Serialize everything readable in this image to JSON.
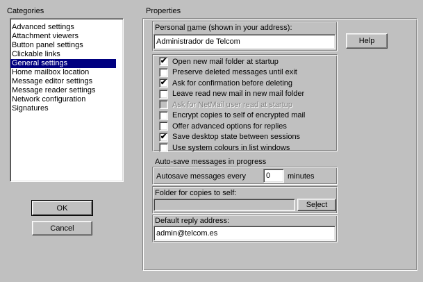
{
  "categories": {
    "title": "Categories",
    "items": [
      {
        "label": "Advanced settings",
        "selected": false
      },
      {
        "label": "Attachment viewers",
        "selected": false
      },
      {
        "label": "Button panel settings",
        "selected": false
      },
      {
        "label": "Clickable links",
        "selected": false
      },
      {
        "label": "General settings",
        "selected": true
      },
      {
        "label": "Home mailbox location",
        "selected": false
      },
      {
        "label": "Message editor settings",
        "selected": false
      },
      {
        "label": "Message reader settings",
        "selected": false
      },
      {
        "label": "Network configuration",
        "selected": false
      },
      {
        "label": "Signatures",
        "selected": false
      }
    ]
  },
  "buttons": {
    "ok": "OK",
    "cancel": "Cancel",
    "help": "Help",
    "select": "Select"
  },
  "properties": {
    "title": "Properties",
    "personal_name": {
      "label": "Personal name (shown in your address):",
      "value": "Administrador de Telcom"
    },
    "checkboxes": [
      {
        "label": "Open new mail folder at startup",
        "checked": true,
        "enabled": true
      },
      {
        "label": "Preserve deleted messages until exit",
        "checked": false,
        "enabled": true
      },
      {
        "label": "Ask for confirmation before deleting",
        "checked": true,
        "enabled": true
      },
      {
        "label": "Leave read new mail in new mail folder",
        "checked": false,
        "enabled": true
      },
      {
        "label": "Ask for NetMail user read at startup",
        "checked": false,
        "enabled": false
      },
      {
        "label": "Encrypt copies to self of encrypted mail",
        "checked": false,
        "enabled": true
      },
      {
        "label": "Offer advanced options for replies",
        "checked": false,
        "enabled": true
      },
      {
        "label": "Save desktop state between sessions",
        "checked": true,
        "enabled": true
      },
      {
        "label": "Use system colours in list windows",
        "checked": false,
        "enabled": true
      }
    ],
    "autosave": {
      "title": "Auto-save messages in progress",
      "label": "Autosave messages every",
      "value": "0",
      "unit": "minutes"
    },
    "copies_folder": {
      "label": "Folder for copies to self:",
      "value": ""
    },
    "reply_address": {
      "label": "Default reply address:",
      "value": "admin@telcom.es"
    }
  },
  "icons": {
    "check": "✔"
  }
}
